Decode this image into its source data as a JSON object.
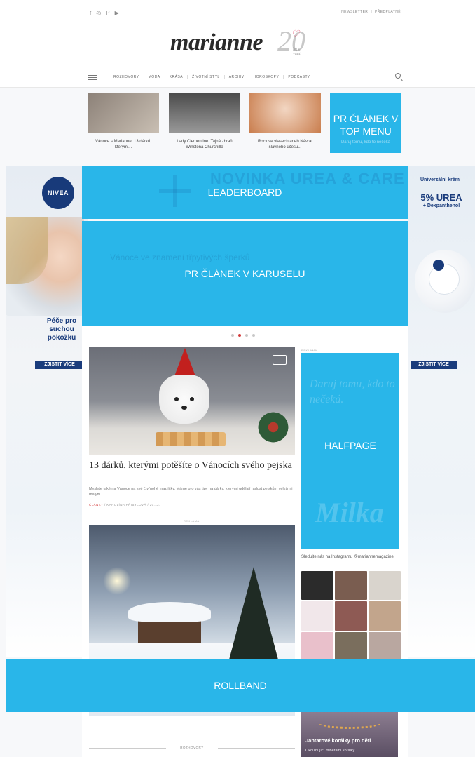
{
  "header": {
    "social_icons": [
      "facebook-icon",
      "instagram-icon",
      "pinterest-icon",
      "youtube-icon"
    ],
    "social_glyphs": [
      "f",
      "◎",
      "P",
      "▶"
    ],
    "top_links": [
      "NEWSLETTER",
      "|",
      "PŘEDPLATNÉ"
    ],
    "logo_text": "marianne",
    "logo_anniversary": "20",
    "logo_anniversary_sub": "let s vámi",
    "nav_items": [
      "ROZHOVORY",
      "MÓDA",
      "KRÁSA",
      "ŽIVOTNÍ STYL",
      "ARCHIV",
      "HOROSKOPY",
      "PODCASTY"
    ]
  },
  "top_menu": {
    "articles": [
      {
        "caption": "Vánoce s Marianne: 13 dárků, kterými...",
        "thumb_colors": [
          "#8c8178",
          "#c9bfb3"
        ]
      },
      {
        "caption": "Lady Clementine. Tajná zbraň Winstona Churchilla",
        "thumb_colors": [
          "#4a4a4a",
          "#9a9a9a"
        ]
      },
      {
        "caption": "Rock ve vlasech aneb Návrat slavného účesu...",
        "thumb_colors": [
          "#c97d4d",
          "#f2d6c2"
        ]
      }
    ],
    "pr_label": "PR ČLÁNEK V TOP MENU",
    "pr_faint": "Daruj tomu, kdo to nečeká"
  },
  "skin_left": {
    "brand": "NIVEA",
    "headline": "Péče pro suchou pokožku",
    "cta": "ZJISTIT VÍCE"
  },
  "skin_right": {
    "headline": "Univerzální krém",
    "big": "5% UREA",
    "sub": "+ Dexpanthenol",
    "cta": "ZJISTIT VÍCE"
  },
  "ads": {
    "leaderboard_label": "LEADERBOARD",
    "leaderboard_ghost": "NOVINKA UREA & CARE",
    "carousel_label": "PR ČLÁNEK V KARUSELU",
    "carousel_ghost": "Vánoce ve znamení třpytivých šperků",
    "carousel_dots": 4,
    "carousel_active": 1,
    "halfpage_label": "HALFPAGE",
    "halfpage_ghost": "Daruj tomu, kdo to nečeká.",
    "halfpage_brand": "Milka",
    "rollband_label": "ROLLBAND",
    "reklama_small": "REKLAMA"
  },
  "articles": [
    {
      "title": "13 dárků, kterými potěšíte o Vánocích svého pejska",
      "perex": "Myslete také na Vánoce na své čtyřnohé mazlíčky. Máme pro vás tipy na dárky, kterými udělají radost pejskům velkým i malým.",
      "category": "ČLÁNKY",
      "sep": "/",
      "author": "KAROLÍNA PŘIBYLOVÁ",
      "date": "20.12."
    },
    {
      "image": "snowy-cabin"
    }
  ],
  "sidebar": {
    "instagram_heading": "Sledujte nás na Instagramu @mariannemagazine",
    "instagram_colors": [
      "#2b2b2b",
      "#7a5d50",
      "#d9d4cd",
      "#f1e7ea",
      "#8e5a54",
      "#c2a58c",
      "#e9c0cb",
      "#7a6e5d",
      "#b9a7a0"
    ],
    "promo_title": "Jantarové korálky pro děti",
    "promo_sub": "Okouzlující minerální korálky"
  },
  "bottom_section": "ROZHOVORY"
}
